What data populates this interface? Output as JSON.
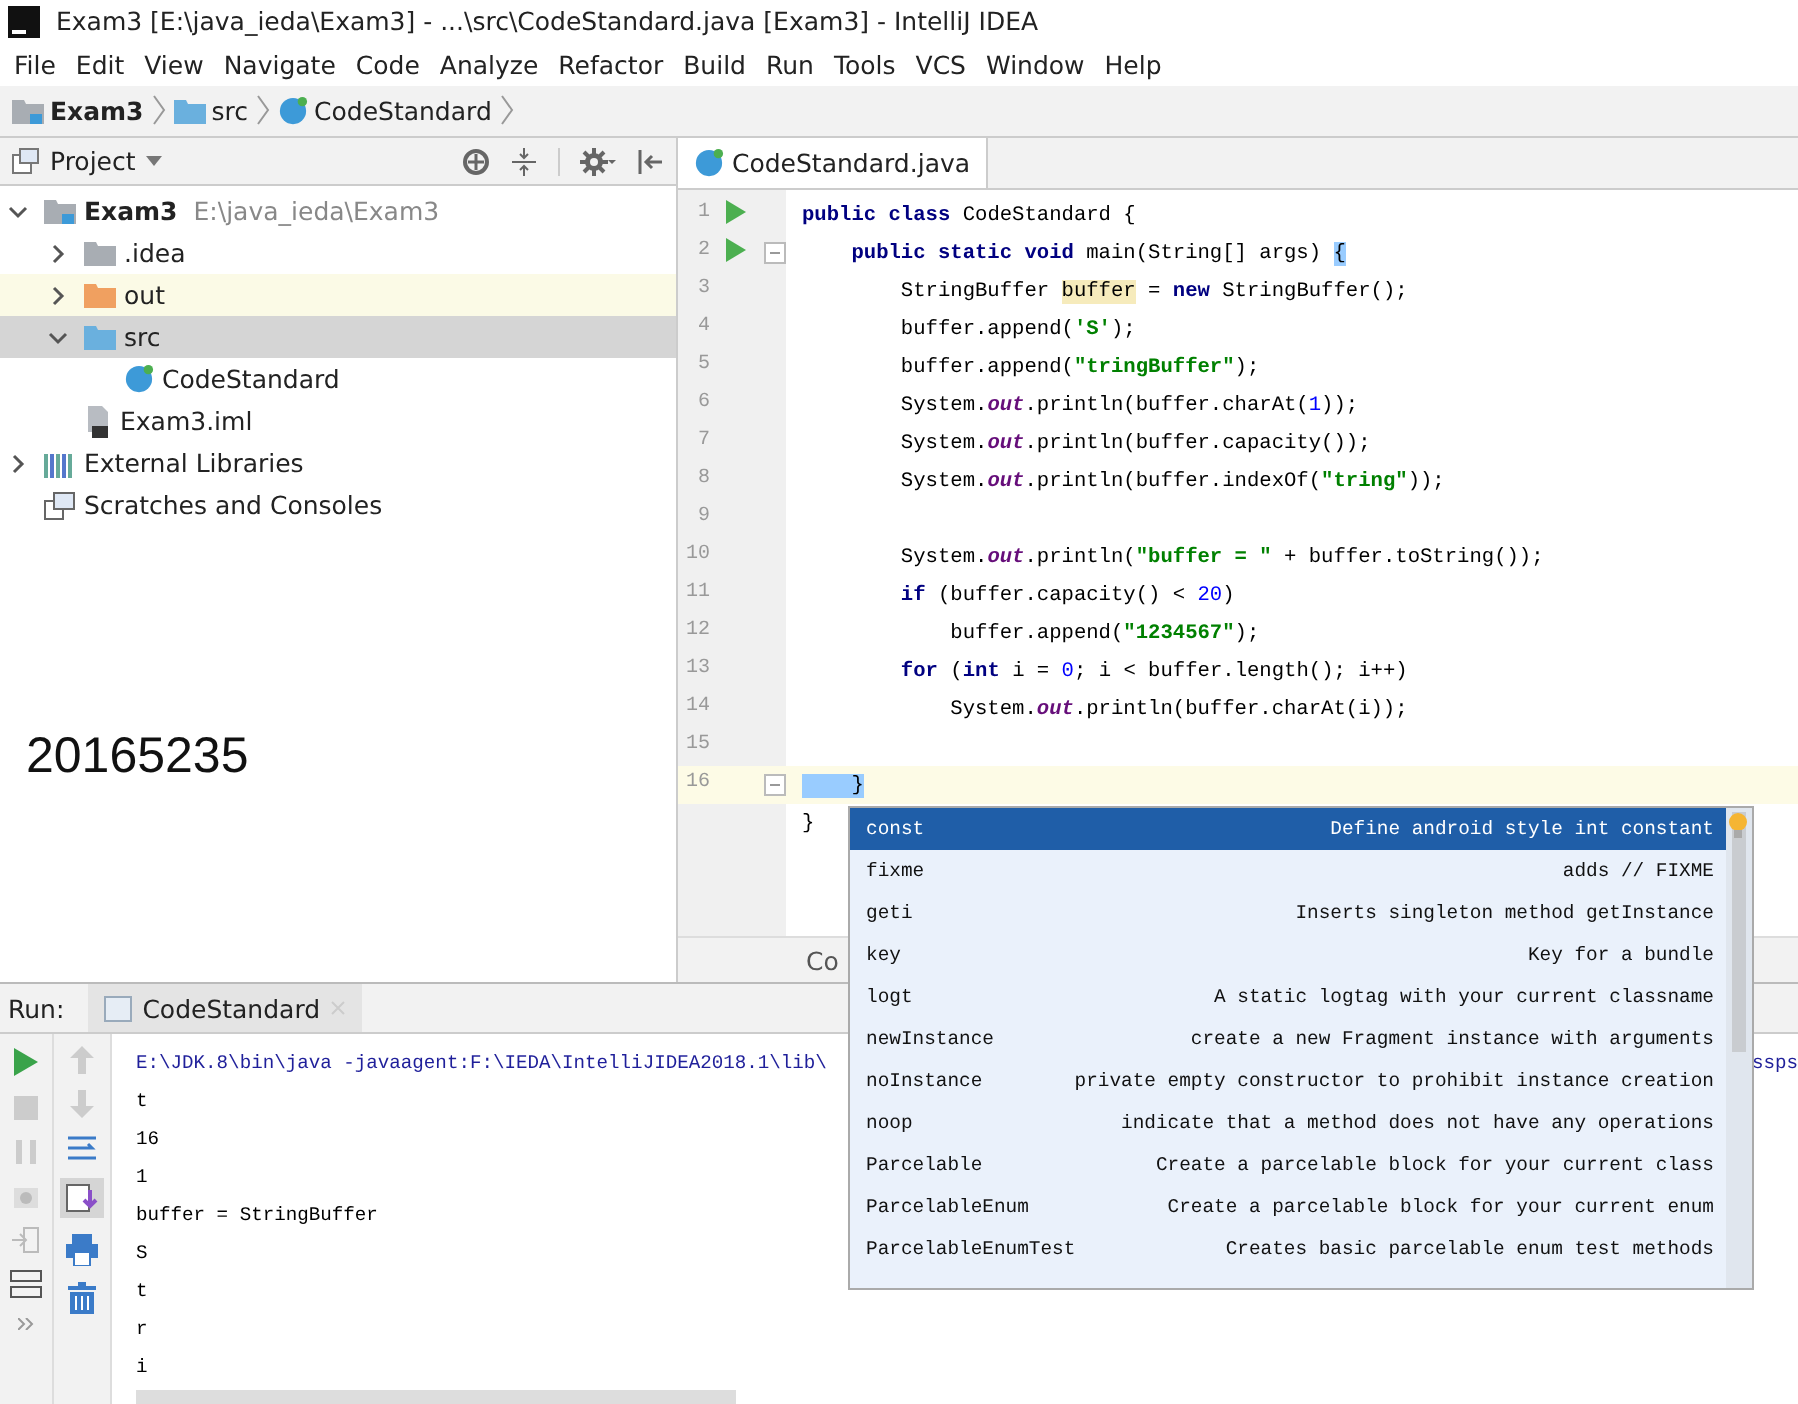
{
  "window": {
    "title": "Exam3 [E:\\java_ieda\\Exam3] - ...\\src\\CodeStandard.java [Exam3] - IntelliJ IDEA"
  },
  "menu": [
    "File",
    "Edit",
    "View",
    "Navigate",
    "Code",
    "Analyze",
    "Refactor",
    "Build",
    "Run",
    "Tools",
    "VCS",
    "Window",
    "Help"
  ],
  "breadcrumbs": [
    {
      "label": "Exam3",
      "kind": "module"
    },
    {
      "label": "src",
      "kind": "folder"
    },
    {
      "label": "CodeStandard",
      "kind": "class"
    }
  ],
  "project": {
    "title": "Project",
    "tree": [
      {
        "label": "Exam3",
        "note": "E:\\java_ieda\\Exam3",
        "kind": "module",
        "expanded": true,
        "selected": false,
        "highlighted": false,
        "children": [
          {
            "label": ".idea",
            "kind": "folder",
            "expanded": false,
            "selected": false,
            "highlighted": false
          },
          {
            "label": "out",
            "kind": "excluded",
            "expanded": false,
            "selected": false,
            "highlighted": true
          },
          {
            "label": "src",
            "kind": "source",
            "expanded": true,
            "selected": true,
            "highlighted": false,
            "children": [
              {
                "label": "CodeStandard",
                "kind": "class",
                "selected": false,
                "highlighted": false
              }
            ]
          },
          {
            "label": "Exam3.iml",
            "kind": "file",
            "selected": false,
            "highlighted": false
          }
        ]
      },
      {
        "label": "External Libraries",
        "kind": "libraries",
        "expanded": false,
        "selected": false,
        "highlighted": false
      },
      {
        "label": "Scratches and Consoles",
        "kind": "scratches",
        "selected": false,
        "highlighted": false
      }
    ],
    "big_text": "20165235"
  },
  "editor": {
    "tabs": [
      {
        "label": "CodeStandard.java",
        "selected": true
      }
    ],
    "lines": [
      {
        "number": "1",
        "run": true,
        "fold": false,
        "current": false,
        "tokens": [
          {
            "kind": "keyword",
            "text": "public class"
          },
          {
            "kind": "plain",
            "text": " CodeStandard {"
          }
        ]
      },
      {
        "number": "2",
        "run": true,
        "fold": true,
        "current": false,
        "tokens": [
          {
            "kind": "keyword",
            "text": "    public static void"
          },
          {
            "kind": "plain",
            "text": " main(String[] args) "
          },
          {
            "kind": "brace",
            "text": "{"
          }
        ]
      },
      {
        "number": "3",
        "run": false,
        "fold": false,
        "current": false,
        "tokens": [
          {
            "kind": "plain",
            "text": "        StringBuffer "
          },
          {
            "kind": "highlight",
            "text": "buffer"
          },
          {
            "kind": "plain",
            "text": " = "
          },
          {
            "kind": "keyword",
            "text": "new"
          },
          {
            "kind": "plain",
            "text": " StringBuffer();"
          }
        ]
      },
      {
        "number": "4",
        "run": false,
        "fold": false,
        "current": false,
        "tokens": [
          {
            "kind": "plain",
            "text": "        buffer.append("
          },
          {
            "kind": "string",
            "text": "'S'"
          },
          {
            "kind": "plain",
            "text": ");"
          }
        ]
      },
      {
        "number": "5",
        "run": false,
        "fold": false,
        "current": false,
        "tokens": [
          {
            "kind": "plain",
            "text": "        buffer.append("
          },
          {
            "kind": "string",
            "text": "\"tringBuffer\""
          },
          {
            "kind": "plain",
            "text": ");"
          }
        ]
      },
      {
        "number": "6",
        "run": false,
        "fold": false,
        "current": false,
        "tokens": [
          {
            "kind": "plain",
            "text": "        System."
          },
          {
            "kind": "field",
            "text": "out"
          },
          {
            "kind": "plain",
            "text": ".println(buffer.charAt("
          },
          {
            "kind": "number",
            "text": "1"
          },
          {
            "kind": "plain",
            "text": "));"
          }
        ]
      },
      {
        "number": "7",
        "run": false,
        "fold": false,
        "current": false,
        "tokens": [
          {
            "kind": "plain",
            "text": "        System."
          },
          {
            "kind": "field",
            "text": "out"
          },
          {
            "kind": "plain",
            "text": ".println(buffer.capacity());"
          }
        ]
      },
      {
        "number": "8",
        "run": false,
        "fold": false,
        "current": false,
        "tokens": [
          {
            "kind": "plain",
            "text": "        System."
          },
          {
            "kind": "field",
            "text": "out"
          },
          {
            "kind": "plain",
            "text": ".println(buffer.indexOf("
          },
          {
            "kind": "string",
            "text": "\"tring\""
          },
          {
            "kind": "plain",
            "text": "));"
          }
        ]
      },
      {
        "number": "9",
        "run": false,
        "fold": false,
        "current": false
      },
      {
        "number": "10",
        "run": false,
        "fold": false,
        "current": false,
        "tokens": [
          {
            "kind": "plain",
            "text": "        System."
          },
          {
            "kind": "field",
            "text": "out"
          },
          {
            "kind": "plain",
            "text": ".println("
          },
          {
            "kind": "string",
            "text": "\"buffer = \""
          },
          {
            "kind": "plain",
            "text": " + buffer.toString());"
          }
        ]
      },
      {
        "number": "11",
        "run": false,
        "fold": false,
        "current": false,
        "tokens": [
          {
            "kind": "keyword",
            "text": "        if"
          },
          {
            "kind": "plain",
            "text": " (buffer.capacity() < "
          },
          {
            "kind": "number",
            "text": "20"
          },
          {
            "kind": "plain",
            "text": ")"
          }
        ]
      },
      {
        "number": "12",
        "run": false,
        "fold": false,
        "current": false,
        "tokens": [
          {
            "kind": "plain",
            "text": "            buffer.append("
          },
          {
            "kind": "string",
            "text": "\"1234567\""
          },
          {
            "kind": "plain",
            "text": ");"
          }
        ]
      },
      {
        "number": "13",
        "run": false,
        "fold": false,
        "current": false,
        "tokens": [
          {
            "kind": "keyword",
            "text": "        for"
          },
          {
            "kind": "plain",
            "text": " ("
          },
          {
            "kind": "keyword",
            "text": "int"
          },
          {
            "kind": "plain",
            "text": " i = "
          },
          {
            "kind": "number",
            "text": "0"
          },
          {
            "kind": "plain",
            "text": "; i < buffer.length(); i++)"
          }
        ]
      },
      {
        "number": "14",
        "run": false,
        "fold": false,
        "current": false,
        "tokens": [
          {
            "kind": "plain",
            "text": "            System."
          },
          {
            "kind": "field",
            "text": "out"
          },
          {
            "kind": "plain",
            "text": ".println(buffer.charAt(i));"
          }
        ]
      },
      {
        "number": "15",
        "run": false,
        "fold": false,
        "current": false
      },
      {
        "number": "16",
        "run": false,
        "fold": true,
        "current": true,
        "tokens": [
          {
            "kind": "brace",
            "text": "    }"
          }
        ]
      },
      {
        "tokens": [
          {
            "kind": "plain",
            "text": "}"
          }
        ]
      }
    ],
    "footer_text": "Co"
  },
  "completion_popup": {
    "items": [
      {
        "name": "const",
        "description": "Define android style int constant",
        "selected": true
      },
      {
        "name": "fixme",
        "description": "adds // FIXME",
        "selected": false
      },
      {
        "name": "geti",
        "description": "Inserts singleton method getInstance",
        "selected": false
      },
      {
        "name": "key",
        "description": "Key for a bundle",
        "selected": false
      },
      {
        "name": "logt",
        "description": "A static logtag with your current classname",
        "selected": false
      },
      {
        "name": "newInstance",
        "description": "create a new Fragment instance with arguments",
        "selected": false
      },
      {
        "name": "noInstance",
        "description": "private empty constructor to prohibit instance creation",
        "selected": false
      },
      {
        "name": "noop",
        "description": "indicate that a method does not have any operations",
        "selected": false
      },
      {
        "name": "Parcelable",
        "description": "Create a parcelable block for your current class",
        "selected": false
      },
      {
        "name": "ParcelableEnum",
        "description": "Create a parcelable block for your current enum",
        "selected": false
      },
      {
        "name": "ParcelableEnumTest",
        "description": "Creates basic parcelable enum test methods",
        "selected": false
      }
    ]
  },
  "run_panel": {
    "label": "Run:",
    "tabs": [
      {
        "label": "CodeStandard",
        "selected": true
      }
    ],
    "console": [
      {
        "kind": "command",
        "text": "E:\\JDK.8\\bin\\java -javaagent:F:\\IEDA\\IntelliJIDEA2018.1\\lib\\",
        "tail": "ssps"
      },
      {
        "kind": "output",
        "text": "t"
      },
      {
        "kind": "output",
        "text": "16"
      },
      {
        "kind": "output",
        "text": "1"
      },
      {
        "kind": "output",
        "text": "buffer = StringBuffer"
      },
      {
        "kind": "output",
        "text": "S"
      },
      {
        "kind": "output",
        "text": "t"
      },
      {
        "kind": "output",
        "text": "r"
      },
      {
        "kind": "output",
        "text": "i"
      }
    ]
  }
}
